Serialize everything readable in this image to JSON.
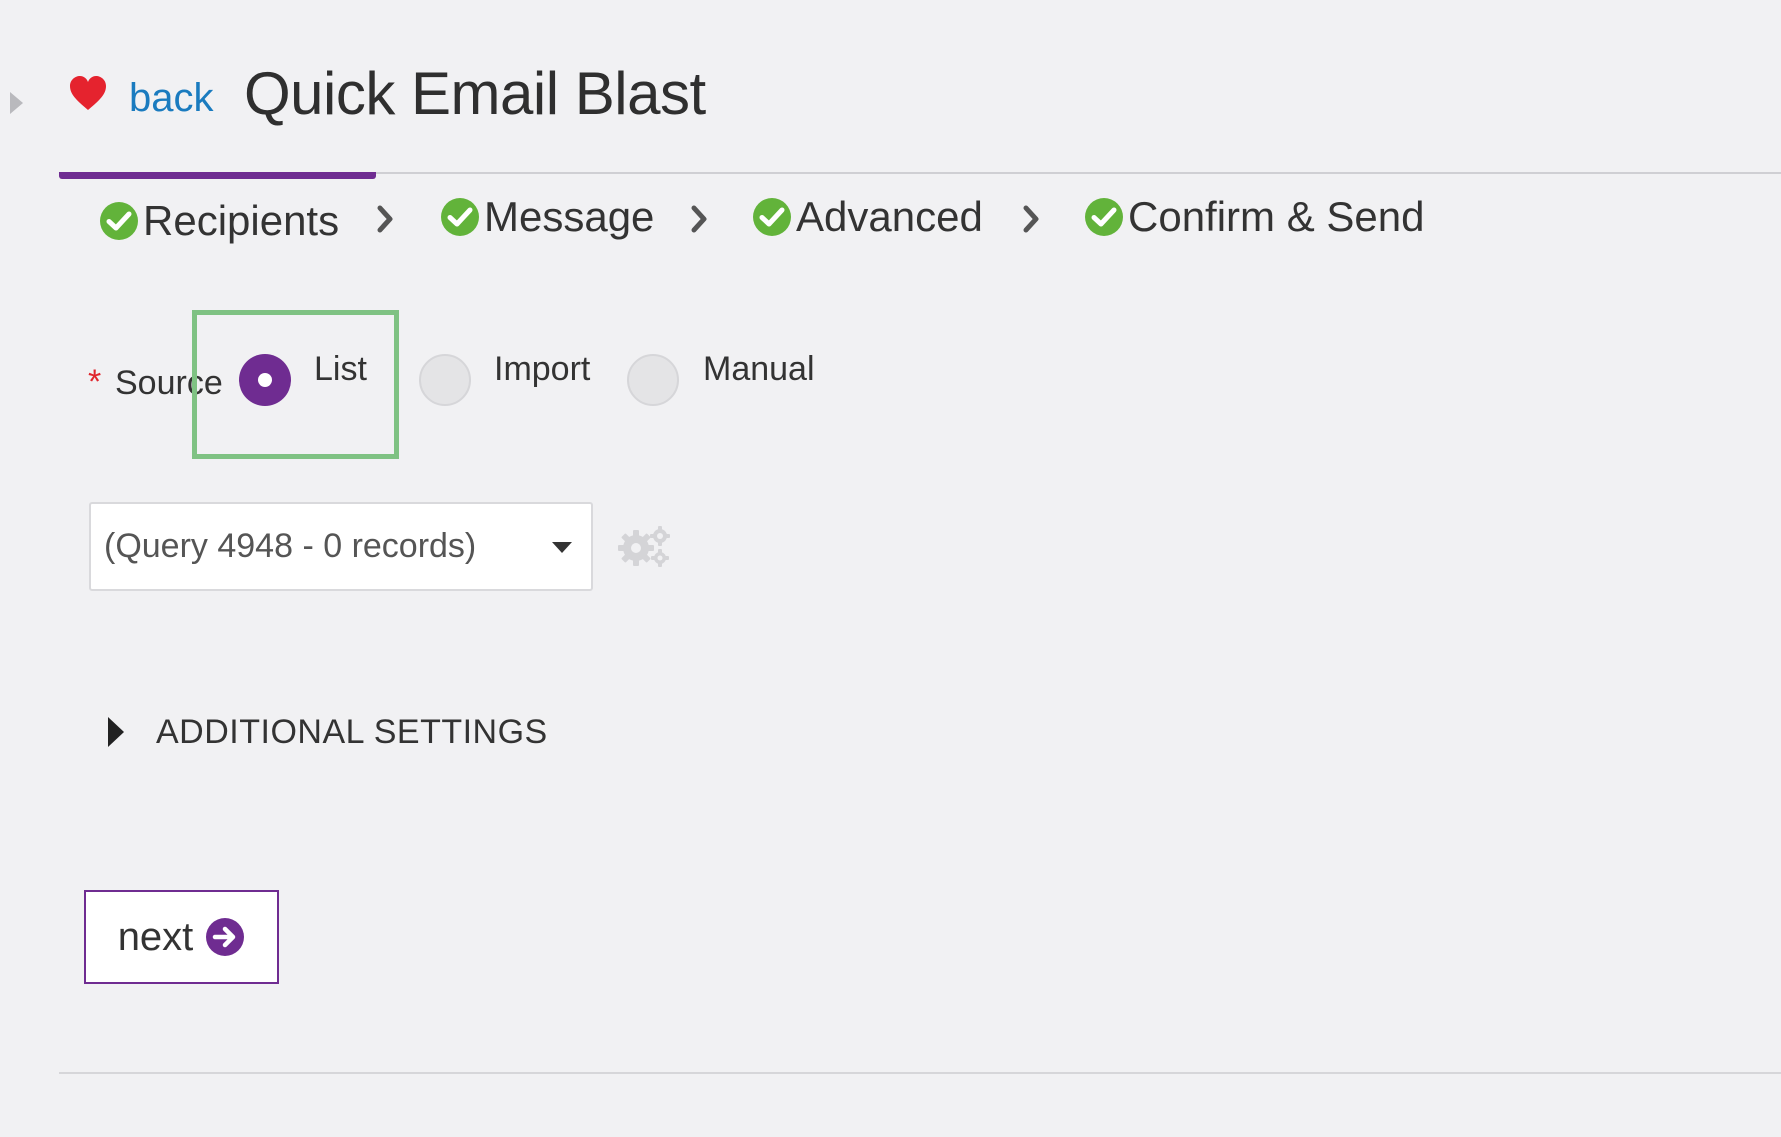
{
  "header": {
    "back_label": "back",
    "title": "Quick Email Blast"
  },
  "steps": [
    {
      "label": "Recipients",
      "status": "complete",
      "active": true
    },
    {
      "label": "Message",
      "status": "complete",
      "active": false
    },
    {
      "label": "Advanced",
      "status": "complete",
      "active": false
    },
    {
      "label": "Confirm & Send",
      "status": "complete",
      "active": false
    }
  ],
  "source": {
    "required_mark": "*",
    "label": "Source",
    "options": [
      {
        "label": "List",
        "selected": true
      },
      {
        "label": "Import",
        "selected": false
      },
      {
        "label": "Manual",
        "selected": false
      }
    ]
  },
  "list_select": {
    "value": "(Query 4948 - 0 records)"
  },
  "additional_settings": {
    "label": "ADDITIONAL SETTINGS"
  },
  "next_button": {
    "label": "next"
  },
  "icons": {
    "favorite": "heart-icon",
    "step_status": "check-circle-icon",
    "step_separator": "chevron-right-icon",
    "settings": "gears-icon",
    "next": "arrow-right-circle-icon"
  },
  "colors": {
    "accent": "#6f2c91",
    "link": "#1a7bbf",
    "check": "#62b33a",
    "required": "#e0262d",
    "highlight": "#7fc283",
    "heart": "#e5232e"
  }
}
